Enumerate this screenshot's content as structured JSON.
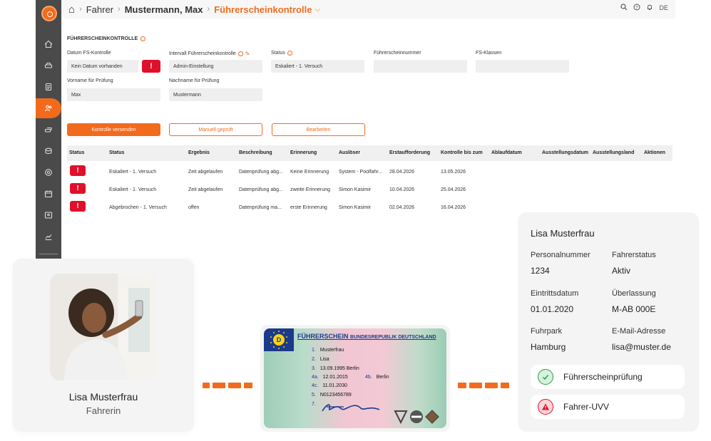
{
  "app": {
    "breadcrumb": {
      "home": "⌂",
      "c1": "Fahrer",
      "c2": "Mustermann, Max",
      "c3": "Führerscheinkontrolle"
    },
    "topbar_right": {
      "lang": "DE"
    },
    "section_title": "FÜHRERSCHEINKONTROLLE",
    "fields": {
      "datum_label": "Datum FS-Kontrolle",
      "datum_value": "Kein Datum vorhanden",
      "intervall_label": "Intervall Führerscheinkontrolle",
      "intervall_value": "Admin-Einstellung",
      "status_label": "Status",
      "status_value": "Eskaliert - 1. Versuch",
      "fsnr_label": "Führerscheinnummer",
      "fsnr_value": "",
      "klassen_label": "FS-Klassen",
      "klassen_value": "",
      "vorname_label": "Vorname für Prüfung",
      "vorname_value": "Max",
      "nachname_label": "Nachname für Prüfung",
      "nachname_value": "Mustermann"
    },
    "buttons": {
      "send": "Kontrolle versenden",
      "manual": "Manuell geprüft",
      "edit": "Bearbeiten"
    },
    "table": {
      "headers": [
        "Status",
        "Status",
        "Ergebnis",
        "Beschreibung",
        "Erinnerung",
        "Auslöser",
        "Erstaufforderung",
        "Kontrolle bis zum",
        "Ablaufdatum",
        "Ausstellungsdatum",
        "Ausstellungsland",
        "Aktionen"
      ],
      "rows": [
        {
          "status": "Eskaliert - 1. Versuch",
          "ergebnis": "Zeit abgelaufen",
          "beschreibung": "Datenprüfung abg...",
          "erinnerung": "Keine Erinnerung",
          "ausloeser": "System - Poolfahr...",
          "erst": "28.04.2026",
          "bis": "13.05.2026"
        },
        {
          "status": "Eskaliert - 1. Versuch",
          "ergebnis": "Zeit abgelaufen",
          "beschreibung": "Datenprüfung abg...",
          "erinnerung": "zweite Erinnerung",
          "ausloeser": "Simon Kasimir",
          "erst": "10.04.2026",
          "bis": "25.04.2026"
        },
        {
          "status": "Abgebrochen - 1. Versuch",
          "ergebnis": "offen",
          "beschreibung": "Datenprüfung ma...",
          "erinnerung": "erste Erinnerung",
          "ausloeser": "Simon Kasimir",
          "erst": "02.04.2026",
          "bis": "16.04.2026"
        }
      ]
    },
    "accent": "#f26b1d",
    "warn_color": "#e0102a"
  },
  "profile_card": {
    "name": "Lisa Musterfrau",
    "role": "Fahrerin"
  },
  "license": {
    "country": "D",
    "title": "FÜHRERSCHEIN",
    "subtitle": "BUNDESREPUBLIK DEUTSCHLAND",
    "lines": [
      {
        "n": "1.",
        "v": "Musterfrau"
      },
      {
        "n": "2.",
        "v": "Lisa"
      },
      {
        "n": "3.",
        "v": "13.09.1995 Berlin"
      },
      {
        "n": "4a.",
        "v": "12.01.2015"
      },
      {
        "n": "4b.",
        "v": "Berlin"
      },
      {
        "n": "4c.",
        "v": "11.01.2030"
      },
      {
        "n": "5.",
        "v": "N0123456789"
      },
      {
        "n": "7.",
        "v": ""
      }
    ]
  },
  "info_card": {
    "name": "Lisa Musterfrau",
    "personalnummer_label": "Personalnummer",
    "personalnummer": "1234",
    "fahrerstatus_label": "Fahrerstatus",
    "fahrerstatus": "Aktiv",
    "eintritt_label": "Eintrittsdatum",
    "eintritt": "01.01.2020",
    "ueberlassung_label": "Überlassung",
    "ueberlassung": "M-AB 000E",
    "fuhrpark_label": "Fuhrpark",
    "fuhrpark": "Hamburg",
    "email_label": "E-Mail-Adresse",
    "email": "lisa@muster.de",
    "check1": "Führerscheinprüfung",
    "check2": "Fahrer-UVV"
  }
}
